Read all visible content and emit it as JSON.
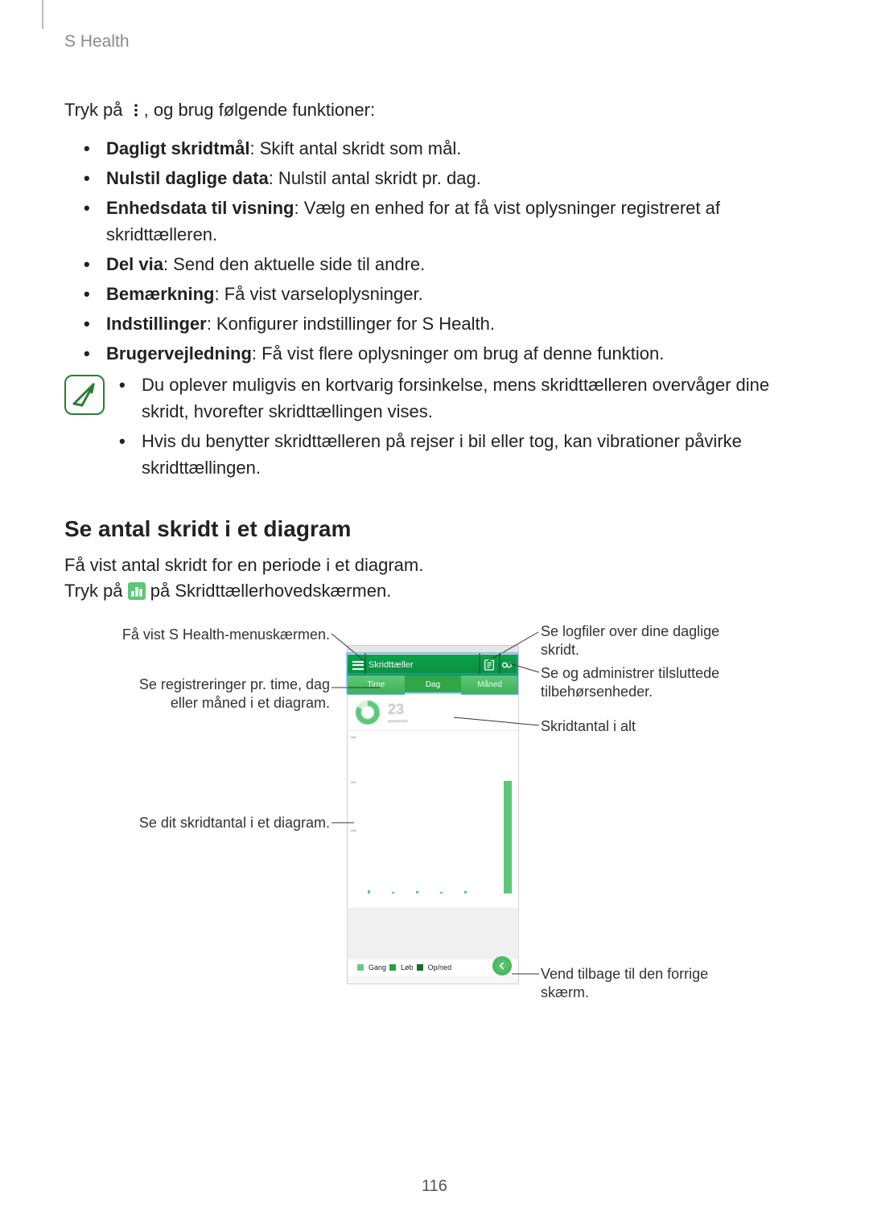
{
  "header": {
    "app_title": "S Health"
  },
  "intro": {
    "lead_prefix": "Tryk på ",
    "lead_suffix": ", og brug følgende funktioner:"
  },
  "menu_items": [
    {
      "term": "Dagligt skridtmål",
      "desc": ": Skift antal skridt som mål."
    },
    {
      "term": "Nulstil daglige data",
      "desc": ": Nulstil antal skridt pr. dag."
    },
    {
      "term": "Enhedsdata til visning",
      "desc": ": Vælg en enhed for at få vist oplysninger registreret af skridttælleren."
    },
    {
      "term": "Del via",
      "desc": ": Send den aktuelle side til andre."
    },
    {
      "term": "Bemærkning",
      "desc": ": Få vist varseloplysninger."
    },
    {
      "term": "Indstillinger",
      "desc": ": Konfigurer indstillinger for S Health."
    },
    {
      "term": "Brugervejledning",
      "desc": ": Få vist flere oplysninger om brug af denne funktion."
    }
  ],
  "notes": [
    "Du oplever muligvis en kortvarig forsinkelse, mens skridttælleren overvåger dine skridt, hvorefter skridttællingen vises.",
    "Hvis du benytter skridttælleren på rejser i bil eller tog, kan vibrationer påvirke skridttællingen."
  ],
  "section": {
    "title": "Se antal skridt i et diagram",
    "p1": "Få vist antal skridt for en periode i et diagram.",
    "p2_prefix": "Tryk på ",
    "p2_suffix": " på Skridttællerhovedskærmen."
  },
  "phone": {
    "appbar_title": "Skridttæller",
    "tabs": [
      "Time",
      "Dag",
      "Måned"
    ],
    "active_tab": 1,
    "summary_value": "23",
    "legend": {
      "walk": "Gang",
      "run": "Løb",
      "updown": "Op/ned"
    }
  },
  "callouts": {
    "left1": "Få vist S Health-menuskærmen.",
    "left2": "Se registreringer pr. time, dag eller måned i et diagram.",
    "left3": "Se dit skridtantal i et diagram.",
    "right1": "Se logfiler over dine daglige skridt.",
    "right2": "Se og administrer tilsluttede tilbehørsenheder.",
    "right3": "Skridtantal i alt",
    "right4": "Vend tilbage til den forrige skærm."
  },
  "page_number": "116"
}
